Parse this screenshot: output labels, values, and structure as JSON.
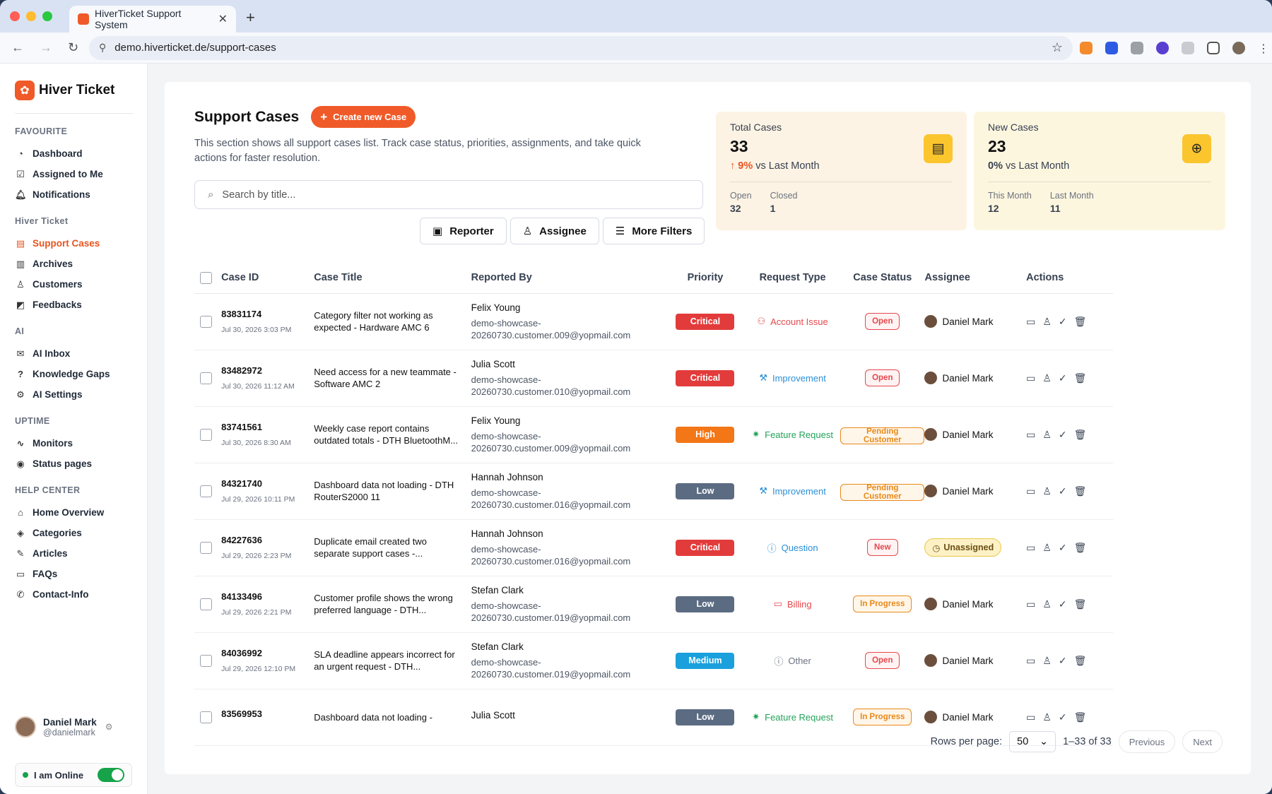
{
  "browser": {
    "tab_title": "HiverTicket Support System",
    "url": "demo.hiverticket.de/support-cases"
  },
  "sidebar": {
    "brand": "Hiver Ticket",
    "sections": [
      {
        "title": "FAVOURITE",
        "items": [
          {
            "label": "Dashboard",
            "icon": "dashboard-icon",
            "glyph": "◔"
          },
          {
            "label": "Assigned to Me",
            "icon": "check-square-icon",
            "glyph": "☑"
          },
          {
            "label": "Notifications",
            "icon": "bell-icon",
            "glyph": "🔔︎"
          }
        ]
      },
      {
        "title": "Hiver Ticket",
        "items": [
          {
            "label": "Support Cases",
            "icon": "clipboard-icon",
            "glyph": "▤",
            "active": true
          },
          {
            "label": "Archives",
            "icon": "trash-icon",
            "glyph": "▥"
          },
          {
            "label": "Customers",
            "icon": "user-icon",
            "glyph": "♙"
          },
          {
            "label": "Feedbacks",
            "icon": "megaphone-icon",
            "glyph": "◩"
          }
        ]
      },
      {
        "title": "AI",
        "items": [
          {
            "label": "AI Inbox",
            "icon": "inbox-icon",
            "glyph": "✉"
          },
          {
            "label": "Knowledge Gaps",
            "icon": "help-circle-icon",
            "glyph": "?"
          },
          {
            "label": "AI Settings",
            "icon": "robot-icon",
            "glyph": "⚙"
          }
        ]
      },
      {
        "title": "UPTIME",
        "items": [
          {
            "label": "Monitors",
            "icon": "activity-icon",
            "glyph": "∿"
          },
          {
            "label": "Status pages",
            "icon": "radio-icon",
            "glyph": "◉"
          }
        ]
      },
      {
        "title": "HELP CENTER",
        "items": [
          {
            "label": "Home Overview",
            "icon": "home-icon",
            "glyph": "⌂"
          },
          {
            "label": "Categories",
            "icon": "layers-icon",
            "glyph": "◈"
          },
          {
            "label": "Articles",
            "icon": "edit-icon",
            "glyph": "✎"
          },
          {
            "label": "FAQs",
            "icon": "chat-icon",
            "glyph": "▭"
          },
          {
            "label": "Contact-Info",
            "icon": "phone-icon",
            "glyph": "✆"
          }
        ]
      }
    ],
    "user": {
      "name": "Daniel Mark",
      "handle": "@danielmark"
    },
    "online_label": "I am Online"
  },
  "page": {
    "title": "Support Cases",
    "create_button": "Create new Case",
    "description": "This section shows all support cases list. Track case status, priorities, assignments, and take quick actions for faster resolution.",
    "search_placeholder": "Search by title...",
    "filters": {
      "reporter": "Reporter",
      "assignee": "Assignee",
      "more": "More Filters"
    }
  },
  "stats": {
    "total": {
      "label": "Total Cases",
      "value": "33",
      "change": "9%",
      "compare": "vs Last Month",
      "left_label": "Open",
      "left_value": "32",
      "right_label": "Closed",
      "right_value": "1"
    },
    "new": {
      "label": "New Cases",
      "value": "23",
      "change": "0%",
      "compare": "vs Last Month",
      "left_label": "This Month",
      "left_value": "12",
      "right_label": "Last Month",
      "right_value": "11"
    }
  },
  "table": {
    "headers": [
      "Case ID",
      "Case Title",
      "Reported By",
      "Priority",
      "Request Type",
      "Case Status",
      "Assignee",
      "Actions"
    ],
    "rows": [
      {
        "id": "83831174",
        "date": "Jul 30, 2026 3:03 PM",
        "title": "Category filter not working as expected - Hardware AMC 6",
        "reporter": "Felix Young",
        "email": "demo-showcase-20260730.customer.009@yopmail.com",
        "priority": "Critical",
        "type": "Account Issue",
        "status": "Open",
        "assignee": "Daniel Mark"
      },
      {
        "id": "83482972",
        "date": "Jul 30, 2026 11:12 AM",
        "title": "Need access for a new teammate - Software AMC 2",
        "reporter": "Julia Scott",
        "email": "demo-showcase-20260730.customer.010@yopmail.com",
        "priority": "Critical",
        "type": "Improvement",
        "status": "Open",
        "assignee": "Daniel Mark"
      },
      {
        "id": "83741561",
        "date": "Jul 30, 2026 8:30 AM",
        "title": "Weekly case report contains outdated totals - DTH BluetoothM...",
        "reporter": "Felix Young",
        "email": "demo-showcase-20260730.customer.009@yopmail.com",
        "priority": "High",
        "type": "Feature Request",
        "status": "Pending Customer",
        "assignee": "Daniel Mark"
      },
      {
        "id": "84321740",
        "date": "Jul 29, 2026 10:11 PM",
        "title": "Dashboard data not loading - DTH RouterS2000 11",
        "reporter": "Hannah Johnson",
        "email": "demo-showcase-20260730.customer.016@yopmail.com",
        "priority": "Low",
        "type": "Improvement",
        "status": "Pending Customer",
        "assignee": "Daniel Mark"
      },
      {
        "id": "84227636",
        "date": "Jul 29, 2026 2:23 PM",
        "title": "Duplicate email created two separate support cases -...",
        "reporter": "Hannah Johnson",
        "email": "demo-showcase-20260730.customer.016@yopmail.com",
        "priority": "Critical",
        "type": "Question",
        "status": "New",
        "assignee": "Unassigned"
      },
      {
        "id": "84133496",
        "date": "Jul 29, 2026 2:21 PM",
        "title": "Customer profile shows the wrong preferred language - DTH...",
        "reporter": "Stefan Clark",
        "email": "demo-showcase-20260730.customer.019@yopmail.com",
        "priority": "Low",
        "type": "Billing",
        "status": "In Progress",
        "assignee": "Daniel Mark"
      },
      {
        "id": "84036992",
        "date": "Jul 29, 2026 12:10 PM",
        "title": "SLA deadline appears incorrect for an urgent request - DTH...",
        "reporter": "Stefan Clark",
        "email": "demo-showcase-20260730.customer.019@yopmail.com",
        "priority": "Medium",
        "type": "Other",
        "status": "Open",
        "assignee": "Daniel Mark"
      },
      {
        "id": "83569953",
        "date": "",
        "title": "Dashboard data not loading -",
        "reporter": "Julia Scott",
        "email": "",
        "priority": "Low",
        "type": "Feature Request",
        "status": "In Progress",
        "assignee": "Daniel Mark"
      }
    ]
  },
  "pagination": {
    "rows_label": "Rows per page:",
    "rows_value": "50",
    "range": "1–33 of 33",
    "prev": "Previous",
    "next": "Next"
  },
  "colors": {
    "accent": "#f05a28",
    "priority": {
      "Critical": "#e23b3b",
      "High": "#f37617",
      "Low": "#5b6b82",
      "Medium": "#1aa0dc"
    },
    "type": {
      "Account Issue": "#e5484d",
      "Improvement": "#2b8fd6",
      "Feature Request": "#22a35a",
      "Question": "#2b8fd6",
      "Billing": "#e5484d",
      "Other": "#6b7280"
    },
    "status": {
      "Open": "#e5484d",
      "Pending Customer": "#e8891a",
      "New": "#e5484d",
      "In Progress": "#e8891a"
    }
  },
  "type_icons": {
    "Account Issue": "user-x-icon",
    "Improvement": "wrench-icon",
    "Feature Request": "sparkle-icon",
    "Question": "help-circle-icon",
    "Billing": "credit-card-icon",
    "Other": "help-circle-icon"
  },
  "type_glyphs": {
    "Account Issue": "⚇",
    "Improvement": "⚒",
    "Feature Request": "✷",
    "Question": "ⓘ",
    "Billing": "▭",
    "Other": "ⓘ"
  }
}
